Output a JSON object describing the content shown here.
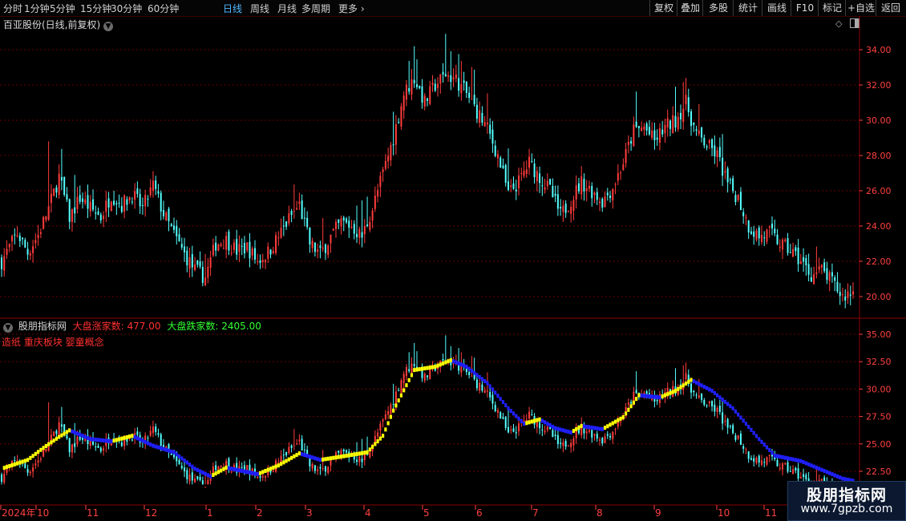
{
  "toolbar": {
    "timeframes": [
      "分时",
      "1分钟",
      "5分钟",
      "15分钟",
      "30分钟",
      "60分钟",
      "日线",
      "周线",
      "月线",
      "多周期",
      "更多"
    ],
    "active": "日线",
    "right_buttons": [
      "复权",
      "叠加",
      "多股",
      "统计",
      "画线",
      "F10",
      "标记",
      "+自选",
      "返回"
    ]
  },
  "stock": {
    "title": "百亚股份(日线,前复权)"
  },
  "indicator": {
    "name": "股朋指标网",
    "rise_label": "大盘涨家数: 477.00",
    "fall_label": "大盘跌家数: 2405.00",
    "concepts": "造纸  重庆板块  婴童概念"
  },
  "axis": {
    "price_labels": [
      "34.00",
      "32.00",
      "30.00",
      "28.00",
      "26.00",
      "24.00",
      "22.00",
      "20.00"
    ],
    "indicator_labels": [
      "35.00",
      "32.50",
      "30.00",
      "27.50",
      "25.00",
      "22.50"
    ],
    "x_labels": [
      "2024年",
      "10",
      "11",
      "12",
      "1",
      "2",
      "3",
      "4",
      "5",
      "6",
      "7",
      "8",
      "9",
      "10",
      "11"
    ]
  },
  "colors": {
    "up": "#ff3c3c",
    "down": "#54ffff",
    "line_up": "#ffff00",
    "line_down": "#2020ff",
    "grid": "#6a0000"
  },
  "watermark": {
    "line1": "股朋指标网",
    "line2": "www.7gpzb.com"
  },
  "chart_data": {
    "type": "candlestick",
    "anchors": [
      [
        0,
        22.0
      ],
      [
        6,
        23.6
      ],
      [
        10,
        22.5
      ],
      [
        14,
        23.5
      ],
      [
        18,
        25.0
      ],
      [
        22,
        26.8
      ],
      [
        26,
        24.5
      ],
      [
        30,
        25.6
      ],
      [
        34,
        25.0
      ],
      [
        38,
        24.5
      ],
      [
        42,
        25.8
      ],
      [
        46,
        25.2
      ],
      [
        50,
        25.8
      ],
      [
        54,
        25.0
      ],
      [
        58,
        26.3
      ],
      [
        62,
        24.7
      ],
      [
        66,
        23.5
      ],
      [
        70,
        22.4
      ],
      [
        74,
        21.5
      ],
      [
        78,
        21.1
      ],
      [
        82,
        23.0
      ],
      [
        86,
        23.2
      ],
      [
        90,
        22.6
      ],
      [
        94,
        22.8
      ],
      [
        98,
        22.0
      ],
      [
        102,
        22.5
      ],
      [
        106,
        23.4
      ],
      [
        110,
        24.4
      ],
      [
        114,
        25.2
      ],
      [
        118,
        23.0
      ],
      [
        122,
        22.4
      ],
      [
        126,
        23.4
      ],
      [
        130,
        24.2
      ],
      [
        134,
        24.0
      ],
      [
        138,
        23.4
      ],
      [
        142,
        25.0
      ],
      [
        146,
        27.0
      ],
      [
        150,
        29.0
      ],
      [
        154,
        31.5
      ],
      [
        158,
        32.4
      ],
      [
        162,
        31.0
      ],
      [
        166,
        32.0
      ],
      [
        170,
        32.6
      ],
      [
        174,
        32.3
      ],
      [
        178,
        31.5
      ],
      [
        182,
        30.5
      ],
      [
        186,
        29.5
      ],
      [
        190,
        28.0
      ],
      [
        194,
        25.8
      ],
      [
        198,
        26.5
      ],
      [
        202,
        27.6
      ],
      [
        206,
        26.8
      ],
      [
        210,
        26.0
      ],
      [
        214,
        24.6
      ],
      [
        218,
        25.5
      ],
      [
        222,
        26.5
      ],
      [
        226,
        26.0
      ],
      [
        230,
        25.4
      ],
      [
        234,
        26.2
      ],
      [
        238,
        27.6
      ],
      [
        242,
        29.4
      ],
      [
        246,
        29.6
      ],
      [
        250,
        28.8
      ],
      [
        254,
        29.6
      ],
      [
        258,
        30.0
      ],
      [
        262,
        31.0
      ],
      [
        266,
        29.2
      ],
      [
        270,
        28.6
      ],
      [
        274,
        28.0
      ],
      [
        278,
        26.4
      ],
      [
        282,
        25.6
      ],
      [
        286,
        24.0
      ],
      [
        290,
        23.4
      ],
      [
        294,
        23.6
      ],
      [
        298,
        23.0
      ],
      [
        302,
        22.6
      ],
      [
        306,
        22.0
      ],
      [
        310,
        21.2
      ],
      [
        314,
        21.5
      ],
      [
        318,
        20.8
      ],
      [
        322,
        20.0
      ],
      [
        326,
        20.3
      ]
    ],
    "ma_anchors": [
      [
        0,
        22.7
      ],
      [
        10,
        23.5
      ],
      [
        16,
        24.6
      ],
      [
        22,
        25.6
      ],
      [
        26,
        26.2
      ],
      [
        34,
        25.4
      ],
      [
        42,
        25.2
      ],
      [
        50,
        25.7
      ],
      [
        58,
        24.8
      ],
      [
        66,
        24.2
      ],
      [
        74,
        22.7
      ],
      [
        80,
        22.0
      ],
      [
        86,
        22.8
      ],
      [
        98,
        22.2
      ],
      [
        106,
        23.0
      ],
      [
        114,
        24.1
      ],
      [
        122,
        23.5
      ],
      [
        130,
        23.8
      ],
      [
        140,
        24.2
      ],
      [
        146,
        25.7
      ],
      [
        150,
        28.0
      ],
      [
        158,
        31.7
      ],
      [
        166,
        32.0
      ],
      [
        172,
        32.6
      ],
      [
        178,
        32.0
      ],
      [
        186,
        30.5
      ],
      [
        194,
        28.2
      ],
      [
        200,
        26.8
      ],
      [
        206,
        27.2
      ],
      [
        212,
        26.4
      ],
      [
        218,
        26.0
      ],
      [
        222,
        26.6
      ],
      [
        230,
        26.3
      ],
      [
        238,
        27.4
      ],
      [
        244,
        29.4
      ],
      [
        252,
        29.2
      ],
      [
        258,
        29.8
      ],
      [
        264,
        30.8
      ],
      [
        272,
        29.8
      ],
      [
        280,
        28.2
      ],
      [
        290,
        25.4
      ],
      [
        296,
        23.9
      ],
      [
        306,
        23.4
      ],
      [
        314,
        22.6
      ],
      [
        322,
        21.8
      ],
      [
        326,
        21.6
      ]
    ],
    "price_range": [
      19.5,
      35.0
    ],
    "indicator_range": [
      21.3,
      35.8
    ]
  }
}
